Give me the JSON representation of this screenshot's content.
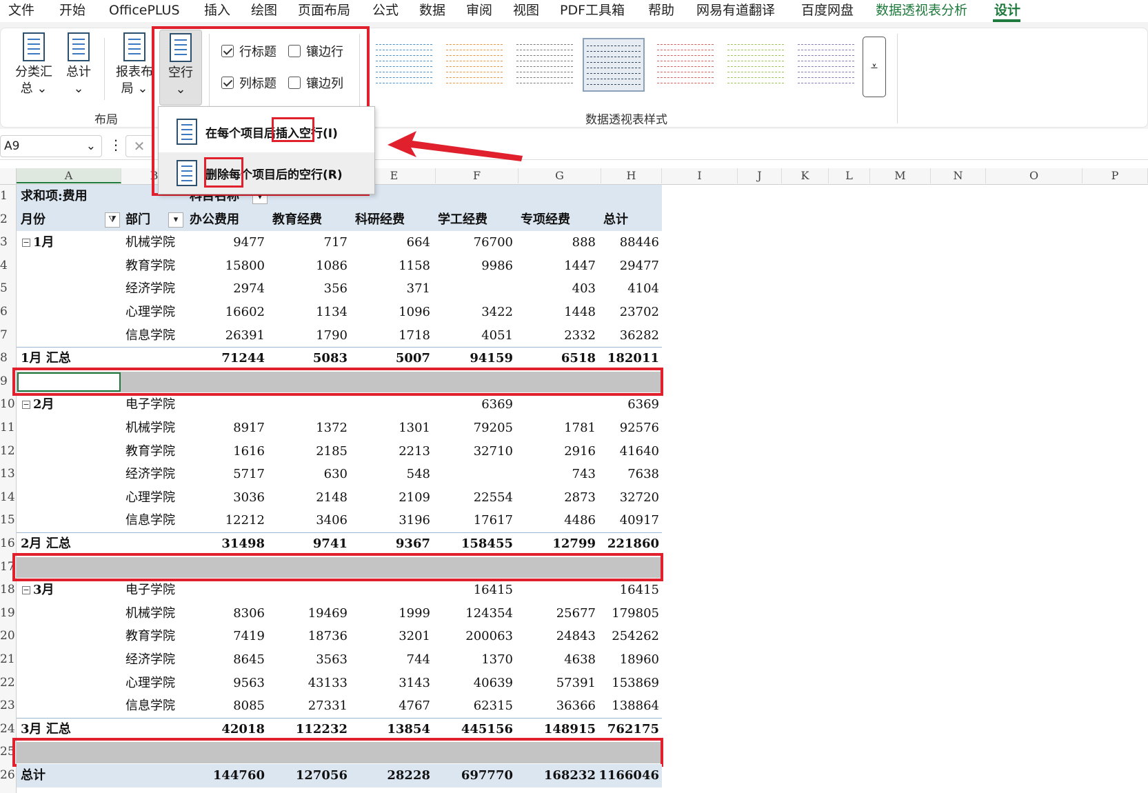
{
  "menu": {
    "items": [
      "文件",
      "开始",
      "OfficePLUS",
      "插入",
      "绘图",
      "页面布局",
      "公式",
      "数据",
      "审阅",
      "视图",
      "PDF工具箱",
      "帮助",
      "网易有道翻译",
      "百度网盘",
      "数据透视表分析",
      "设计"
    ],
    "accent_color": "#1e7a3c"
  },
  "ribbon": {
    "layout_group": {
      "label": "布局",
      "subtotal_line1": "分类汇",
      "subtotal_line2": "总",
      "grandtotal": "总计",
      "report_layout_line1": "报表布",
      "report_layout_line2": "局",
      "blank_rows": "空行"
    },
    "options": {
      "row_headers": {
        "label": "行标题",
        "checked": true
      },
      "col_headers": {
        "label": "列标题",
        "checked": true
      },
      "banded_rows": {
        "label": "镶边行",
        "checked": false
      },
      "banded_cols": {
        "label": "镶边列",
        "checked": false
      }
    },
    "styles_group_label": "数据透视表样式",
    "style_colors": [
      "#4a90c8",
      "#e9963c",
      "#7a7a7a",
      "#34495e",
      "#d0605c",
      "#a3bf5a",
      "#8878b8"
    ]
  },
  "dropdown": {
    "insert_label": "在每个项目后插入空行(I)",
    "remove_label": "删除每个项目后的空行(R)"
  },
  "formula_bar": {
    "name_box": "A9"
  },
  "columns": [
    "A",
    "B",
    "C",
    "D",
    "E",
    "F",
    "G",
    "H",
    "I",
    "J",
    "K",
    "L",
    "M",
    "N",
    "O",
    "P"
  ],
  "pivot": {
    "r1_label": "求和项:费用",
    "r1_col_field": "科目名称",
    "headers": [
      "月份",
      "部门",
      "办公费用",
      "教育经费",
      "科研经费",
      "学工经费",
      "专项经费",
      "总计"
    ],
    "rows": [
      {
        "row": "3",
        "month": "1月",
        "dept": "机械学院",
        "vals": [
          "9477",
          "717",
          "664",
          "76700",
          "888",
          "88446"
        ]
      },
      {
        "row": "4",
        "month": "",
        "dept": "教育学院",
        "vals": [
          "15800",
          "1086",
          "1158",
          "9986",
          "1447",
          "29477"
        ]
      },
      {
        "row": "5",
        "month": "",
        "dept": "经济学院",
        "vals": [
          "2974",
          "356",
          "371",
          "",
          "403",
          "4104"
        ]
      },
      {
        "row": "6",
        "month": "",
        "dept": "心理学院",
        "vals": [
          "16602",
          "1134",
          "1096",
          "3422",
          "1448",
          "23702"
        ]
      },
      {
        "row": "7",
        "month": "",
        "dept": "信息学院",
        "vals": [
          "26391",
          "1790",
          "1718",
          "4051",
          "2332",
          "36282"
        ]
      },
      {
        "row": "8",
        "month": "1月  汇总",
        "dept": "",
        "vals": [
          "71244",
          "5083",
          "5007",
          "94159",
          "6518",
          "182011"
        ],
        "total": true
      },
      {
        "row": "9",
        "blank": true
      },
      {
        "row": "10",
        "month": "2月",
        "dept": "电子学院",
        "vals": [
          "",
          "",
          "",
          "6369",
          "",
          "6369"
        ]
      },
      {
        "row": "11",
        "month": "",
        "dept": "机械学院",
        "vals": [
          "8917",
          "1372",
          "1301",
          "79205",
          "1781",
          "92576"
        ]
      },
      {
        "row": "12",
        "month": "",
        "dept": "教育学院",
        "vals": [
          "1616",
          "2185",
          "2213",
          "32710",
          "2916",
          "41640"
        ]
      },
      {
        "row": "13",
        "month": "",
        "dept": "经济学院",
        "vals": [
          "5717",
          "630",
          "548",
          "",
          "743",
          "7638"
        ]
      },
      {
        "row": "14",
        "month": "",
        "dept": "心理学院",
        "vals": [
          "3036",
          "2148",
          "2109",
          "22554",
          "2873",
          "32720"
        ]
      },
      {
        "row": "15",
        "month": "",
        "dept": "信息学院",
        "vals": [
          "12212",
          "3406",
          "3196",
          "17617",
          "4486",
          "40917"
        ]
      },
      {
        "row": "16",
        "month": "2月  汇总",
        "dept": "",
        "vals": [
          "31498",
          "9741",
          "9367",
          "158455",
          "12799",
          "221860"
        ],
        "total": true
      },
      {
        "row": "17",
        "blank": true
      },
      {
        "row": "18",
        "month": "3月",
        "dept": "电子学院",
        "vals": [
          "",
          "",
          "",
          "16415",
          "",
          "16415"
        ]
      },
      {
        "row": "19",
        "month": "",
        "dept": "机械学院",
        "vals": [
          "8306",
          "19469",
          "1999",
          "124354",
          "25677",
          "179805"
        ]
      },
      {
        "row": "20",
        "month": "",
        "dept": "教育学院",
        "vals": [
          "7419",
          "18736",
          "3201",
          "200063",
          "24843",
          "254262"
        ]
      },
      {
        "row": "21",
        "month": "",
        "dept": "经济学院",
        "vals": [
          "8645",
          "3563",
          "744",
          "1370",
          "4638",
          "18960"
        ]
      },
      {
        "row": "22",
        "month": "",
        "dept": "心理学院",
        "vals": [
          "9563",
          "43133",
          "3143",
          "40639",
          "57391",
          "153869"
        ]
      },
      {
        "row": "23",
        "month": "",
        "dept": "信息学院",
        "vals": [
          "8085",
          "27331",
          "4767",
          "62315",
          "36366",
          "138864"
        ]
      },
      {
        "row": "24",
        "month": "3月  汇总",
        "dept": "",
        "vals": [
          "42018",
          "112232",
          "13854",
          "445156",
          "148915",
          "762175"
        ],
        "total": true
      },
      {
        "row": "25",
        "blank": true
      },
      {
        "row": "26",
        "month": "总计",
        "dept": "",
        "vals": [
          "144760",
          "127056",
          "28228",
          "697770",
          "168232",
          "1166046"
        ],
        "total": true,
        "grand": true
      }
    ]
  }
}
